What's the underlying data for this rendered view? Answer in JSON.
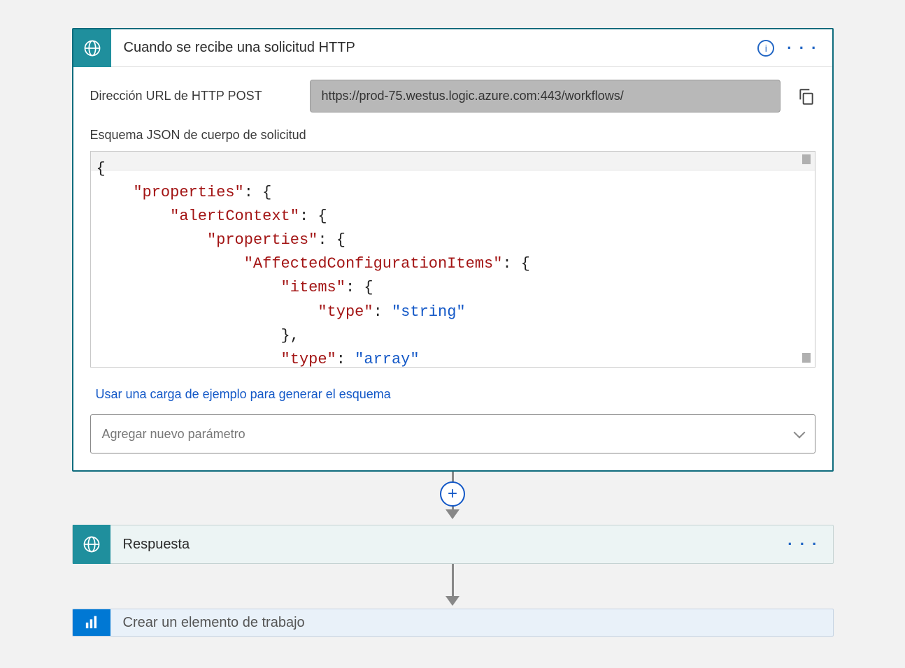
{
  "trigger": {
    "title": "Cuando se recibe una solicitud HTTP",
    "url_label": "Dirección URL de HTTP POST",
    "url_value": "https://prod-75.westus.logic.azure.com:443/workflows/",
    "schema_label": "Esquema JSON de cuerpo de solicitud",
    "code": {
      "l1": "{",
      "l2a": "\"properties\"",
      "l2b": ": {",
      "l3a": "\"alertContext\"",
      "l3b": ": {",
      "l4a": "\"properties\"",
      "l4b": ": {",
      "l5a": "\"AffectedConfigurationItems\"",
      "l5b": ": {",
      "l6a": "\"items\"",
      "l6b": ": {",
      "l7a": "\"type\"",
      "l7b": ": ",
      "l7c": "\"string\"",
      "l8": "},",
      "l9a": "\"type\"",
      "l9b": ": ",
      "l9c": "\"array\""
    },
    "sample_link": "Usar una carga de ejemplo para generar el esquema",
    "add_param_placeholder": "Agregar nuevo parámetro"
  },
  "response": {
    "title": "Respuesta"
  },
  "workitem": {
    "title": "Crear un elemento de trabajo"
  }
}
